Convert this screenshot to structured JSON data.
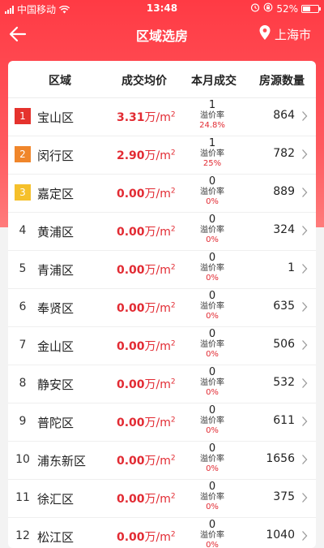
{
  "status_bar": {
    "carrier": "中国移动",
    "time": "13:48",
    "battery_percent": "52%",
    "battery_level": 0.52
  },
  "nav": {
    "title": "区域选房",
    "city": "上海市"
  },
  "table": {
    "headers": {
      "district": "区域",
      "avg_price": "成交均价",
      "monthly_sales": "本月成交",
      "listings": "房源数量"
    },
    "price_unit": "万/m",
    "price_unit_sup": "2",
    "premium_label": "溢价率",
    "rows": [
      {
        "rank": "1",
        "district": "宝山区",
        "price": "3.31",
        "sales": "1",
        "premium": "24.8%",
        "listings": "864"
      },
      {
        "rank": "2",
        "district": "闵行区",
        "price": "2.90",
        "sales": "1",
        "premium": "25%",
        "listings": "782"
      },
      {
        "rank": "3",
        "district": "嘉定区",
        "price": "0.00",
        "sales": "0",
        "premium": "0%",
        "listings": "889"
      },
      {
        "rank": "4",
        "district": "黄浦区",
        "price": "0.00",
        "sales": "0",
        "premium": "0%",
        "listings": "324"
      },
      {
        "rank": "5",
        "district": "青浦区",
        "price": "0.00",
        "sales": "0",
        "premium": "0%",
        "listings": "1"
      },
      {
        "rank": "6",
        "district": "奉贤区",
        "price": "0.00",
        "sales": "0",
        "premium": "0%",
        "listings": "635"
      },
      {
        "rank": "7",
        "district": "金山区",
        "price": "0.00",
        "sales": "0",
        "premium": "0%",
        "listings": "506"
      },
      {
        "rank": "8",
        "district": "静安区",
        "price": "0.00",
        "sales": "0",
        "premium": "0%",
        "listings": "532"
      },
      {
        "rank": "9",
        "district": "普陀区",
        "price": "0.00",
        "sales": "0",
        "premium": "0%",
        "listings": "611"
      },
      {
        "rank": "10",
        "district": "浦东新区",
        "price": "0.00",
        "sales": "0",
        "premium": "0%",
        "listings": "1656"
      },
      {
        "rank": "11",
        "district": "徐汇区",
        "price": "0.00",
        "sales": "0",
        "premium": "0%",
        "listings": "375"
      },
      {
        "rank": "12",
        "district": "松江区",
        "price": "0.00",
        "sales": "0",
        "premium": "0%",
        "listings": "1040"
      }
    ]
  },
  "colors": {
    "accent": "#e22b33",
    "header_gradient_top": "#ff3a44",
    "rank_1": "#e5322d",
    "rank_2": "#f0862b",
    "rank_3": "#f5c02b"
  },
  "icons": {
    "back": "back-arrow-icon",
    "location": "location-pin-icon",
    "row_chevron": "chevron-right-icon"
  }
}
